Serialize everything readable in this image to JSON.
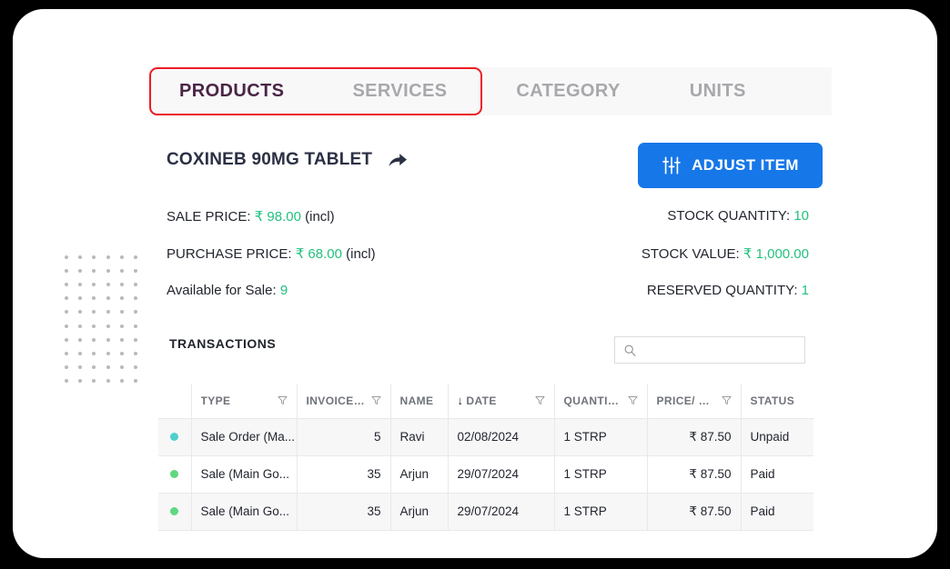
{
  "tabs": [
    {
      "id": "products",
      "label": "PRODUCTS",
      "active": true
    },
    {
      "id": "services",
      "label": "SERVICES",
      "active": false
    },
    {
      "id": "category",
      "label": "CATEGORY",
      "active": false
    },
    {
      "id": "units",
      "label": "UNITS",
      "active": false
    }
  ],
  "product": {
    "title": "COXINEB 90MG TABLET",
    "share_icon": "share-arrow-icon"
  },
  "adjust_button": {
    "label": "ADJUST ITEM",
    "icon": "sliders-adjust-icon",
    "color": "#1677e8"
  },
  "stats_left": [
    {
      "label": "SALE PRICE:",
      "value": "₹ 98.00",
      "suffix": "(incl)"
    },
    {
      "label": "PURCHASE PRICE:",
      "value": "₹ 68.00",
      "suffix": "(incl)"
    },
    {
      "label": "Available for Sale:",
      "value": "9",
      "suffix": ""
    }
  ],
  "stats_right": [
    {
      "label": "STOCK QUANTITY:",
      "value": "10",
      "suffix": ""
    },
    {
      "label": "STOCK VALUE:",
      "value": "₹ 1,000.00",
      "suffix": ""
    },
    {
      "label": "RESERVED QUANTITY:",
      "value": "1",
      "suffix": ""
    }
  ],
  "value_color": "#22c07d",
  "transactions": {
    "title": "TRANSACTIONS",
    "search": {
      "value": "",
      "placeholder": "",
      "icon": "search-icon"
    },
    "columns": [
      {
        "key": "dot",
        "label": "",
        "filter": false,
        "sorted": false,
        "align": "left"
      },
      {
        "key": "type",
        "label": "TYPE",
        "filter": true,
        "sorted": false,
        "align": "left"
      },
      {
        "key": "invoice",
        "label": "INVOICE/R...",
        "filter": true,
        "sorted": false,
        "align": "right"
      },
      {
        "key": "name",
        "label": "NAME",
        "filter": false,
        "sorted": false,
        "align": "left"
      },
      {
        "key": "date",
        "label": "DATE",
        "filter": true,
        "sorted": true,
        "align": "left"
      },
      {
        "key": "quantity",
        "label": "QUANTITY",
        "filter": true,
        "sorted": false,
        "align": "left"
      },
      {
        "key": "price",
        "label": "PRICE/ UNIT",
        "filter": true,
        "sorted": false,
        "align": "right"
      },
      {
        "key": "status",
        "label": "STATUS",
        "filter": false,
        "sorted": false,
        "align": "left"
      }
    ],
    "rows": [
      {
        "dot_color": "#4ecfca",
        "type": "Sale Order (Ma...",
        "invoice": "5",
        "name": "Ravi",
        "date": "02/08/2024",
        "quantity": "1 STRP",
        "price": "₹ 87.50",
        "status": "Unpaid"
      },
      {
        "dot_color": "#5ed880",
        "type": "Sale (Main Go...",
        "invoice": "35",
        "name": "Arjun",
        "date": "29/07/2024",
        "quantity": "1 STRP",
        "price": "₹ 87.50",
        "status": "Paid"
      },
      {
        "dot_color": "#5ed880",
        "type": "Sale (Main Go...",
        "invoice": "35",
        "name": "Arjun",
        "date": "29/07/2024",
        "quantity": "1 STRP",
        "price": "₹ 87.50",
        "status": "Paid"
      }
    ]
  },
  "highlight": {
    "color": "#ed1c24",
    "target": "products-tab"
  }
}
